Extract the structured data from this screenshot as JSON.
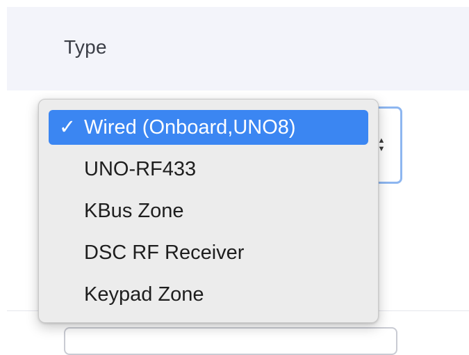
{
  "column_header": {
    "label": "Type"
  },
  "type_select": {
    "selected_value": "Wired (Onboard,UNO8)",
    "check_mark": "✓",
    "arrow_up": "▲",
    "arrow_down": "▼",
    "options": [
      {
        "label": "Wired (Onboard,UNO8)",
        "selected": true
      },
      {
        "label": "UNO-RF433",
        "selected": false
      },
      {
        "label": "KBus Zone",
        "selected": false
      },
      {
        "label": "DSC RF Receiver",
        "selected": false
      },
      {
        "label": "Keypad Zone",
        "selected": false
      }
    ]
  },
  "colors": {
    "highlight": "#3b86f2",
    "focus_ring": "#8db6f0",
    "header_background": "#f3f4fa",
    "popup_background": "#ececec"
  }
}
